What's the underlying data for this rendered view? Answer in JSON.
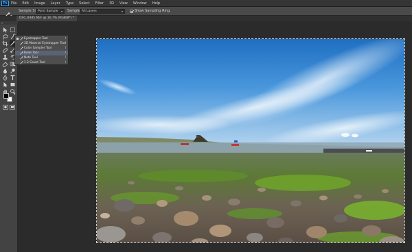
{
  "app": {
    "logo": "Ps"
  },
  "menu": [
    "File",
    "Edit",
    "Image",
    "Layer",
    "Type",
    "Select",
    "Filter",
    "3D",
    "View",
    "Window",
    "Help"
  ],
  "options_bar": {
    "sample_size_label": "Sample Size:",
    "sample_size_value": "Point Sample",
    "sample_label": "Sample:",
    "sample_value": "All Layers",
    "show_ring_label": "Show Sampling Ring",
    "show_ring_checked": true
  },
  "document_tab": {
    "label": "DSC_9385.NEF @ 16.7% (RGB/8*) *"
  },
  "flyout": {
    "items": [
      {
        "label": "Eyedropper Tool",
        "key": "I",
        "icon": "eyedropper-icon",
        "active": true,
        "selected": false
      },
      {
        "label": "3D Material Eyedropper Tool",
        "key": "I",
        "icon": "3d-eyedropper-icon",
        "active": false,
        "selected": false
      },
      {
        "label": "Color Sampler Tool",
        "key": "I",
        "icon": "color-sampler-icon",
        "active": false,
        "selected": false
      },
      {
        "label": "Ruler Tool",
        "key": "I",
        "icon": "ruler-icon",
        "active": false,
        "selected": true
      },
      {
        "label": "Note Tool",
        "key": "I",
        "icon": "note-icon",
        "active": false,
        "selected": false
      },
      {
        "label": "1 2 Count Tool",
        "key": "I",
        "icon": "count-icon",
        "active": false,
        "selected": false
      }
    ]
  },
  "colors": {
    "foreground": "#000000",
    "background": "#ffffff",
    "menubar": "#353535",
    "options_bar": "#4a4a4a",
    "workspace": "#2b2b2b",
    "selection_highlight": "#5b6275"
  }
}
